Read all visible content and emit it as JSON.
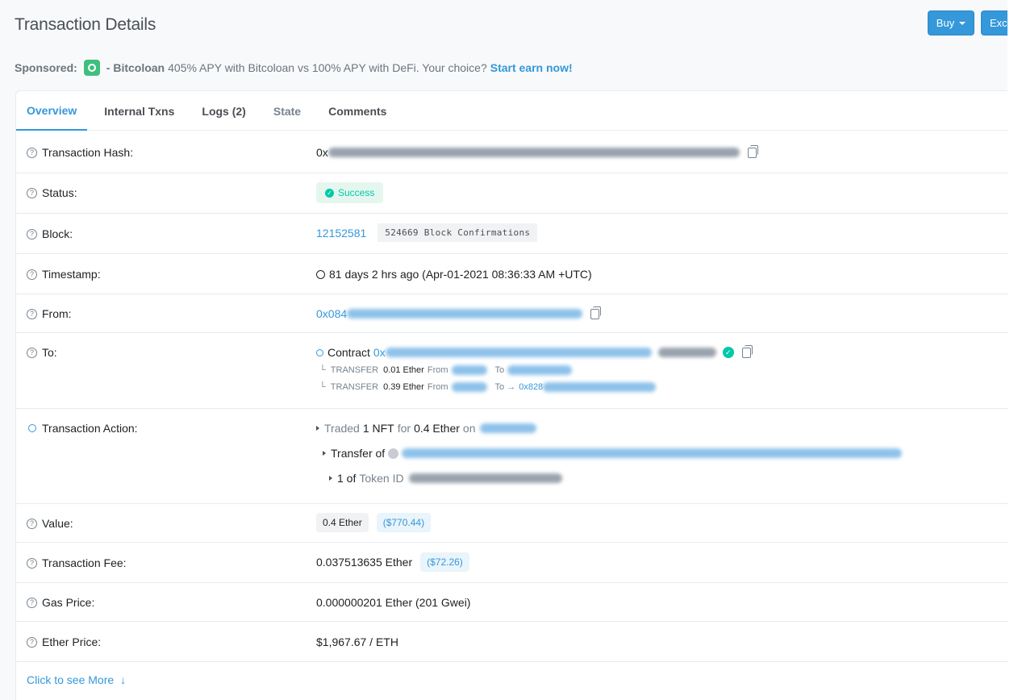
{
  "header": {
    "title": "Transaction Details",
    "buy_label": "Buy",
    "exchange_label": "Exc"
  },
  "sponsored": {
    "label": "Sponsored:",
    "name": "- Bitcoloan",
    "text": "- 405% APY with Bitcoloan vs 100% APY with DeFi. Your choice?",
    "cta": "Start earn now!"
  },
  "tabs": [
    {
      "label": "Overview"
    },
    {
      "label": "Internal Txns"
    },
    {
      "label": "Logs (2)"
    },
    {
      "label": "State"
    },
    {
      "label": "Comments"
    }
  ],
  "rows": {
    "hash": {
      "label": "Transaction Hash:",
      "prefix": "0x"
    },
    "status": {
      "label": "Status:",
      "value": "Success"
    },
    "block": {
      "label": "Block:",
      "value": "12152581",
      "confirmations": "524669 Block Confirmations"
    },
    "timestamp": {
      "label": "Timestamp:",
      "value": "81 days 2 hrs ago (Apr-01-2021 08:36:33 AM +UTC)"
    },
    "from": {
      "label": "From:",
      "prefix": "0x084"
    },
    "to": {
      "label": "To:",
      "contract_label": "Contract",
      "prefix": "0x",
      "transfers": [
        {
          "marker": "└",
          "type": "TRANSFER",
          "amount": "0.01 Ether",
          "from_label": "From",
          "to_label": "To"
        },
        {
          "marker": "└",
          "type": "TRANSFER",
          "amount": "0.39 Ether",
          "from_label": "From",
          "to_label": "To →",
          "to_prefix": "0x828"
        }
      ]
    },
    "action": {
      "label": "Transaction Action:",
      "traded": "Traded",
      "count": "1 NFT",
      "for_label": "for",
      "amount": "0.4 Ether",
      "on_label": "on",
      "transfer_label": "Transfer of",
      "of_label": "1 of",
      "token_label": "Token ID"
    },
    "value": {
      "label": "Value:",
      "amount": "0.4 Ether",
      "usd": "($770.44)"
    },
    "fee": {
      "label": "Transaction Fee:",
      "amount": "0.037513635 Ether",
      "usd": "($72.26)"
    },
    "gas": {
      "label": "Gas Price:",
      "value": "0.000000201 Ether (201 Gwei)"
    },
    "ether_price": {
      "label": "Ether Price:",
      "value": "$1,967.67 / ETH"
    }
  },
  "footer": {
    "more_label": "Click to see More",
    "more_arrow": "↓"
  }
}
